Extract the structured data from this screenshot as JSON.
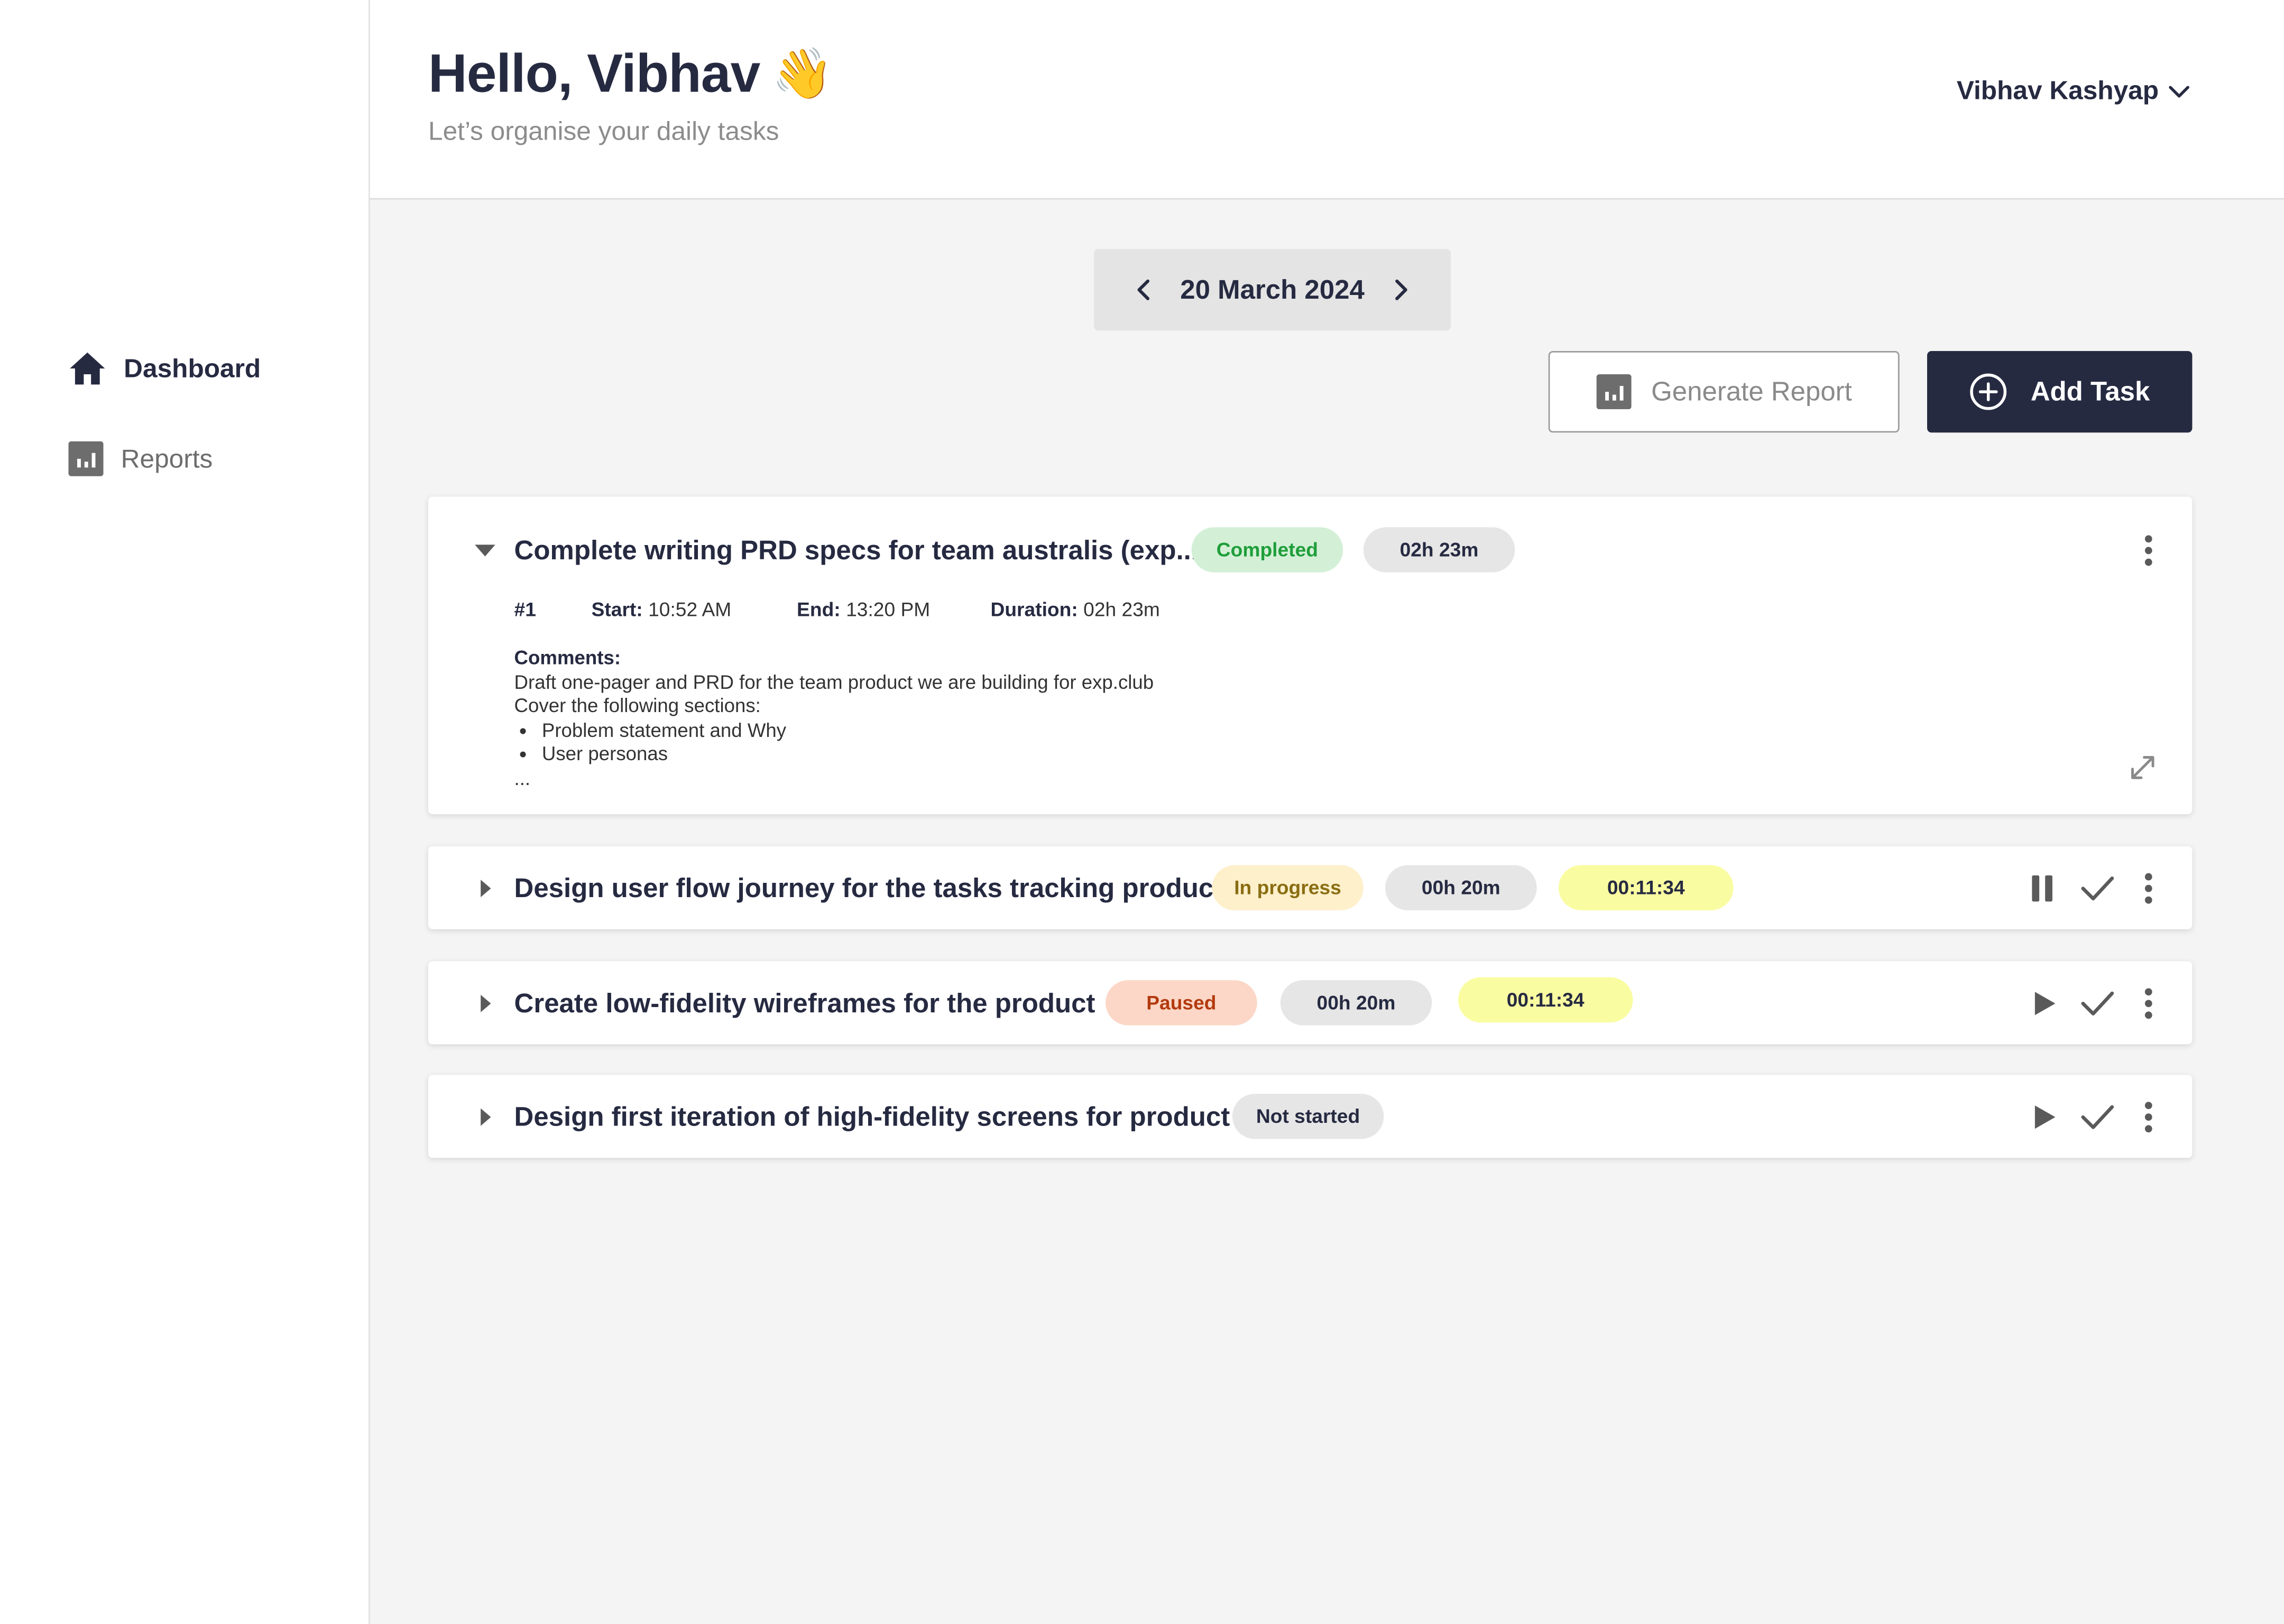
{
  "sidebar": {
    "items": [
      {
        "label": "Dashboard",
        "icon": "home-icon",
        "active": true
      },
      {
        "label": "Reports",
        "icon": "report-chart-icon",
        "active": false
      }
    ]
  },
  "header": {
    "greeting": "Hello, Vibhav",
    "greeting_emoji": "👋",
    "subtitle": "Let’s organise your daily tasks",
    "user_name": "Vibhav Kashyap"
  },
  "date_nav": {
    "date": "20 March 2024"
  },
  "actions": {
    "generate_report": "Generate Report",
    "add_task": "Add Task"
  },
  "colors": {
    "primary": "#262a41",
    "completed_bg": "#d3f0d6",
    "completed_text": "#1e9e3a",
    "in_progress_bg": "#fdf0cb",
    "in_progress_text": "#8a6d12",
    "paused_bg": "#fcd7c7",
    "paused_text": "#b33a0e",
    "timer_bg": "#fafca2",
    "neutral_pill_bg": "#e6e6e6"
  },
  "tasks": [
    {
      "title": "Complete writing PRD specs for team australis (exp...",
      "status": "Completed",
      "duration": "02h 23m",
      "expanded": true,
      "details": {
        "number": "#1",
        "start_label": "Start:",
        "start": "10:52 AM",
        "end_label": "End:",
        "end": "13:20 PM",
        "duration_label": "Duration:",
        "duration": "02h 23m",
        "comments_label": "Comments:",
        "comment_lines": [
          "Draft one-pager and PRD for the team product we are building for exp.club",
          "Cover the following sections:"
        ],
        "bullets": [
          "Problem statement and Why",
          "User personas"
        ],
        "ellipsis": "..."
      }
    },
    {
      "title": "Design user flow journey for the tasks tracking product",
      "status": "In progress",
      "duration": "00h 20m",
      "timer": "00:11:34",
      "expanded": false
    },
    {
      "title": "Create low-fidelity wireframes for the product",
      "status": "Paused",
      "duration": "00h 20m",
      "timer": "00:11:34",
      "expanded": false
    },
    {
      "title": "Design first iteration of high-fidelity screens for product",
      "status": "Not started",
      "expanded": false
    }
  ]
}
